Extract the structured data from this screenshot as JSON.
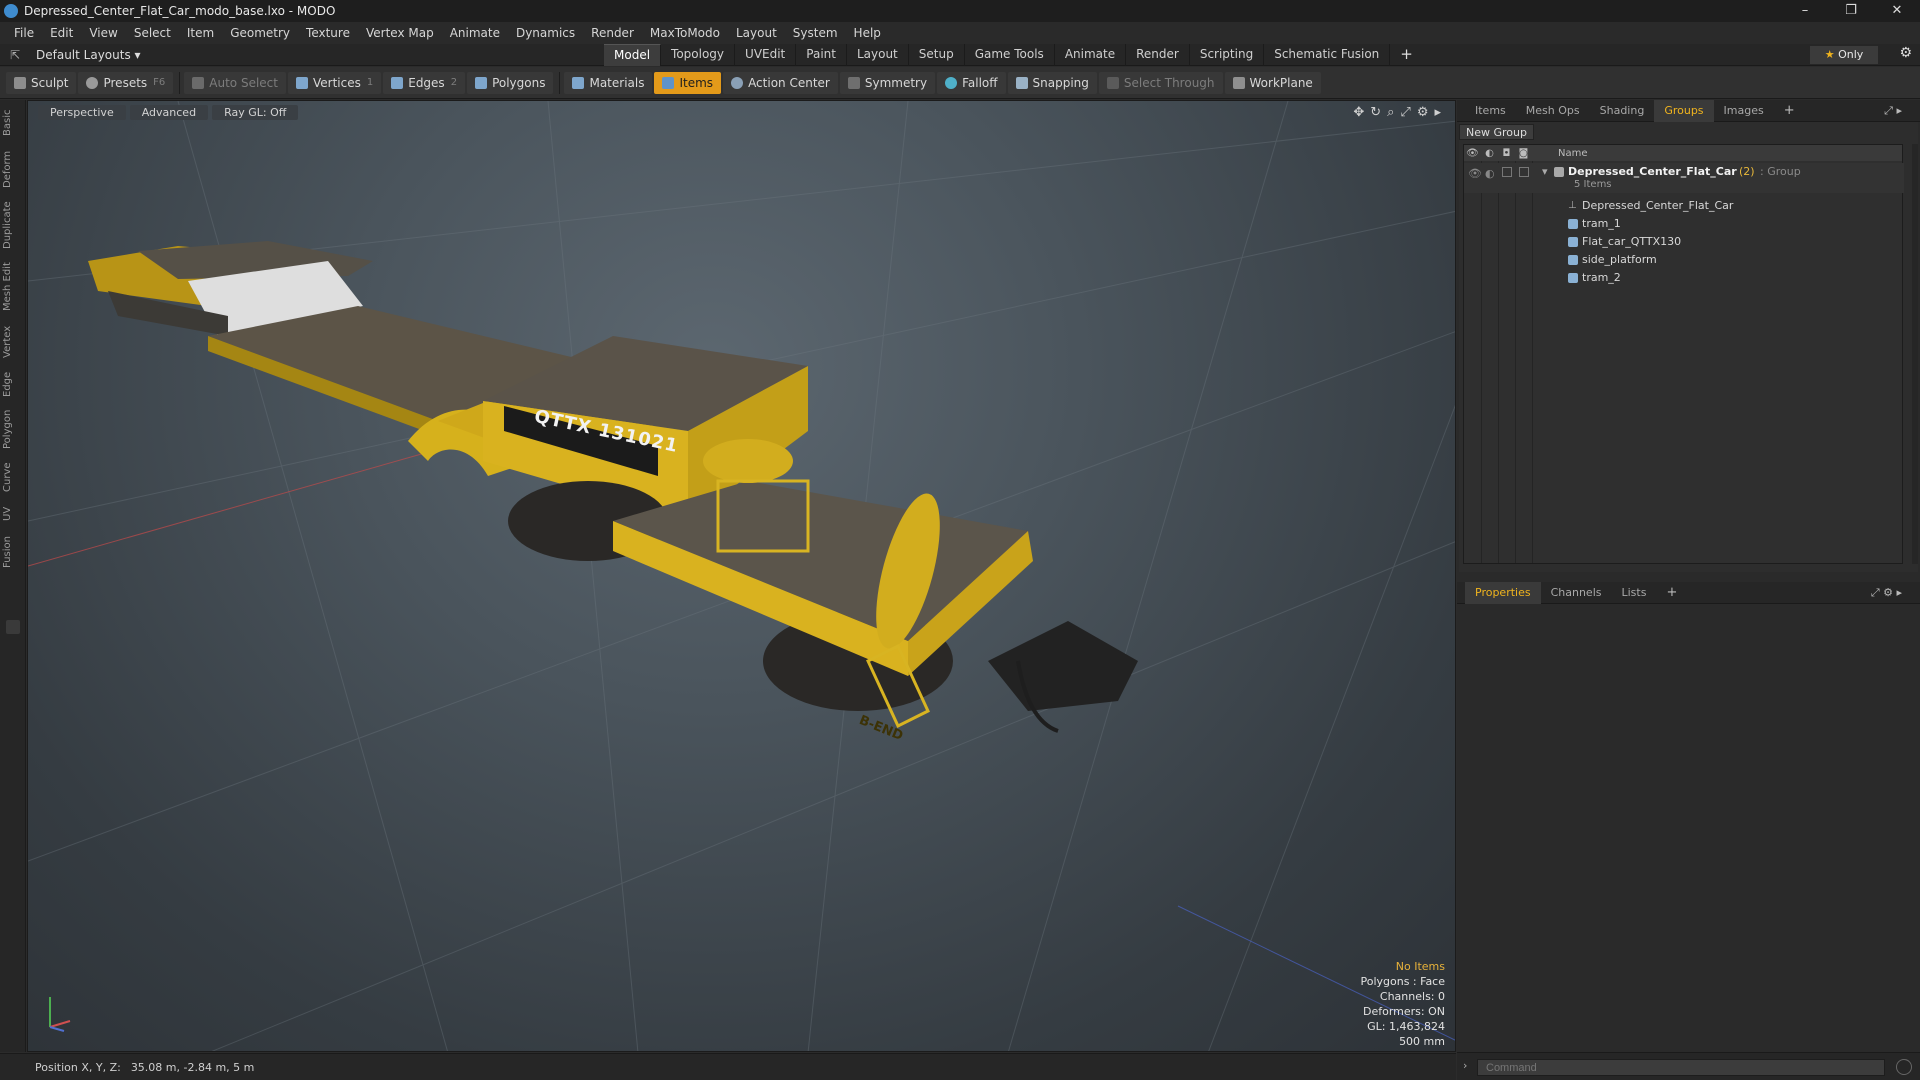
{
  "window": {
    "title": "Depressed_Center_Flat_Car_modo_base.lxo - MODO",
    "minimize": "–",
    "maximize": "❐",
    "close": "✕"
  },
  "menu": [
    "File",
    "Edit",
    "View",
    "Select",
    "Item",
    "Geometry",
    "Texture",
    "Vertex Map",
    "Animate",
    "Dynamics",
    "Render",
    "MaxToModo",
    "Layout",
    "System",
    "Help"
  ],
  "layout_selector": "Default Layouts ▾",
  "layout_tabs": [
    "Model",
    "Topology",
    "UVEdit",
    "Paint",
    "Layout",
    "Setup",
    "Game Tools",
    "Animate",
    "Render",
    "Scripting",
    "Schematic Fusion"
  ],
  "layout_tabs_active": "Model",
  "only_label": "Only",
  "toolbar": {
    "sculpt": "Sculpt",
    "presets": "Presets",
    "presets_key": "F6",
    "auto_select": "Auto Select",
    "vertices": "Vertices",
    "vertices_key": "1",
    "edges": "Edges",
    "edges_key": "2",
    "polygons": "Polygons",
    "materials": "Materials",
    "items": "Items",
    "action_center": "Action Center",
    "symmetry": "Symmetry",
    "falloff": "Falloff",
    "snapping": "Snapping",
    "select_through": "Select Through",
    "workplane": "WorkPlane"
  },
  "left_tabs": [
    "Basic",
    "Deform",
    "Duplicate",
    "Mesh Edit",
    "Vertex",
    "Edge",
    "Polygon",
    "Curve",
    "UV",
    "Fusion"
  ],
  "viewport": {
    "view_mode": "Perspective",
    "shading": "Advanced",
    "raygl": "Ray GL: Off",
    "info": {
      "no_items": "No Items",
      "polygons": "Polygons : Face",
      "channels": "Channels: 0",
      "deformers": "Deformers: ON",
      "gl": "GL: 1,463,824",
      "scale": "500 mm"
    },
    "decal_text": "QTTX 131021",
    "decal_b_end": "B-END"
  },
  "status": {
    "label": "Position X, Y, Z:",
    "value": "35.08 m, -2.84 m, 5 m"
  },
  "right_tabs_top": [
    "Items",
    "Mesh Ops",
    "Shading",
    "Groups",
    "Images"
  ],
  "right_tabs_top_active": "Groups",
  "groups": {
    "new_group": "New Group",
    "col_name": "Name",
    "root": {
      "name": "Depressed_Center_Flat_Car",
      "count": "(2)",
      "kind": ": Group",
      "sub": "5 Items"
    },
    "children": [
      "Depressed_Center_Flat_Car",
      "tram_1",
      "Flat_car_QTTX130",
      "side_platform",
      "tram_2"
    ]
  },
  "right_tabs_bottom": [
    "Properties",
    "Channels",
    "Lists"
  ],
  "right_tabs_bottom_active": "Properties",
  "command_placeholder": "Command",
  "colors": {
    "accent": "#f0b41e",
    "items_highlight": "#e39a1a",
    "car_yellow": "#d9b21f"
  }
}
